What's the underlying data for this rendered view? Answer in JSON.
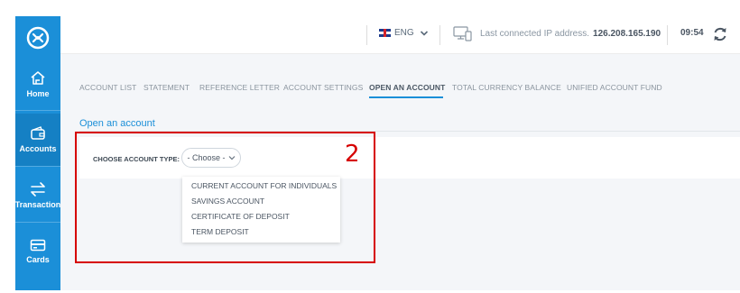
{
  "sidebar": {
    "logo_icon": "logo-icon",
    "items": [
      {
        "label": "Home",
        "icon": "home-icon"
      },
      {
        "label": "Accounts",
        "icon": "wallet-icon"
      },
      {
        "label": "Transaction",
        "icon": "transfer-arrows-icon"
      },
      {
        "label": "Cards",
        "icon": "card-icon"
      }
    ],
    "active_item": "Accounts",
    "color": "#1b8fd8"
  },
  "topbar": {
    "language": "ENG",
    "ip_label": "Last connected IP address.",
    "ip_value": "126.208.165.190",
    "time": "09:54"
  },
  "tabs": [
    {
      "label": "ACCOUNT LIST"
    },
    {
      "label": "STATEMENT"
    },
    {
      "label": "REFERENCE LETTER"
    },
    {
      "label": "ACCOUNT SETTINGS"
    },
    {
      "label": "OPEN AN ACCOUNT"
    },
    {
      "label": "TOTAL CURRENCY BALANCE"
    },
    {
      "label": "UNIFIED ACCOUNT FUND"
    }
  ],
  "active_tab": "OPEN AN ACCOUNT",
  "content": {
    "section_title": "Open an account",
    "field_label": "CHOOSE ACCOUNT TYPE:",
    "select_value": "- Choose -",
    "options": [
      "CURRENT ACCOUNT FOR INDIVIDUALS",
      "SAVINGS ACCOUNT",
      "CERTIFICATE OF DEPOSIT",
      "TERM DEPOSIT"
    ]
  },
  "annotation": {
    "number": "2",
    "color": "#d60000"
  }
}
